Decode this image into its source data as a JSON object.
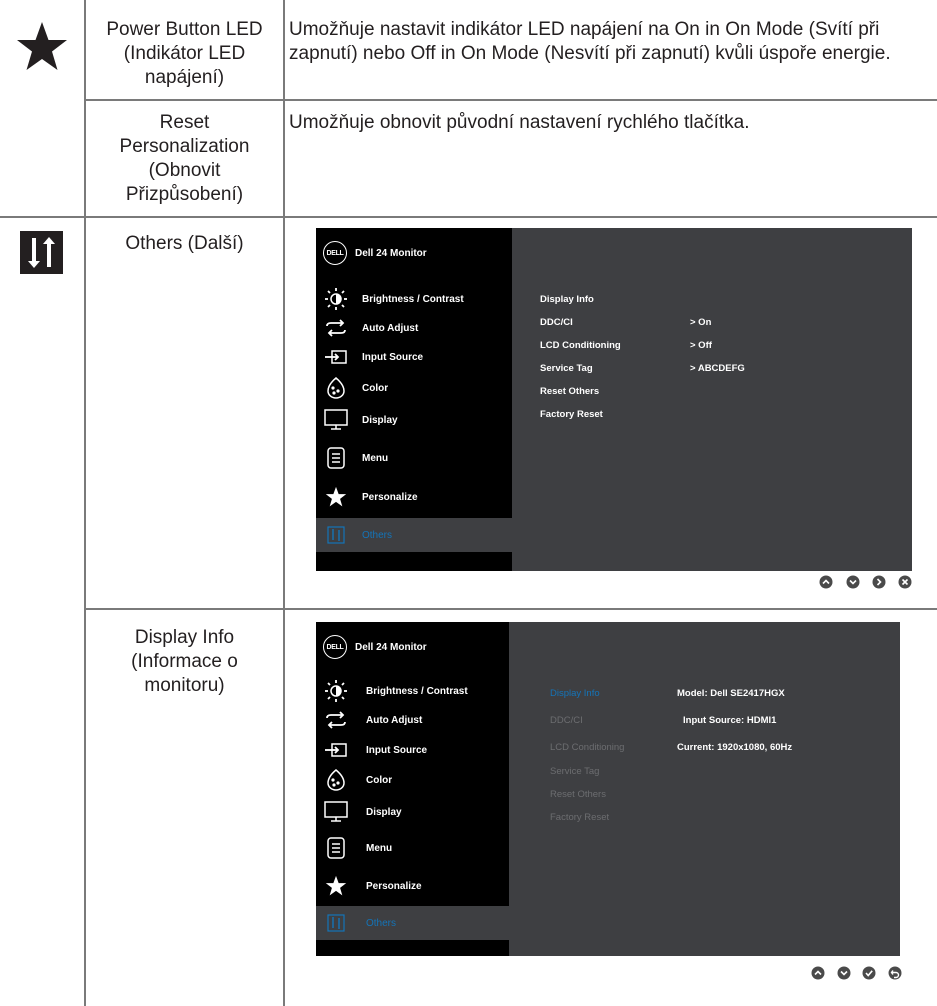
{
  "rows": [
    {
      "label": "Power Button LED\n(Indikátor LED\nnapájení)",
      "description": "Umožňuje nastavit indikátor LED napájení na On in On Mode (Svítí při zapnutí) nebo Off in On Mode (Nesvítí při zapnutí) kvůli úspoře energie.",
      "icon": "star-icon"
    },
    {
      "label": "Reset\nPersonalization\n(Obnovit\nPřizpůsobení)",
      "description": "Umožňuje obnovit původní nastavení rychlého tlačítka."
    },
    {
      "label": "Others (Další)",
      "icon": "others-sliders-icon"
    },
    {
      "label": "Display Info\n(Informace o\nmonitoru)"
    }
  ],
  "osd": {
    "brand": "DELL",
    "title": "Dell 24 Monitor",
    "menu": [
      {
        "label": "Brightness / Contrast",
        "icon": "brightness-icon"
      },
      {
        "label": "Auto Adjust",
        "icon": "auto-adjust-icon"
      },
      {
        "label": "Input Source",
        "icon": "input-source-icon"
      },
      {
        "label": "Color",
        "icon": "color-icon"
      },
      {
        "label": "Display",
        "icon": "display-icon"
      },
      {
        "label": "Menu",
        "icon": "menu-icon"
      },
      {
        "label": "Personalize",
        "icon": "star-icon"
      },
      {
        "label": "Others",
        "icon": "others-icon"
      }
    ],
    "others_items": [
      {
        "label": "Display Info",
        "value": ""
      },
      {
        "label": "DDC/CI",
        "value": ">  On"
      },
      {
        "label": "LCD Conditioning",
        "value": ">  Off"
      },
      {
        "label": "Service Tag",
        "value": ">  ABCDEFG"
      },
      {
        "label": "Reset Others",
        "value": ""
      },
      {
        "label": "Factory Reset",
        "value": ""
      }
    ],
    "info_values": [
      "Model:  Dell SE2417HGX",
      "Input Source: HDMI1",
      "Current: 1920x1080, 60Hz"
    ],
    "nav_buttons_1": [
      "up-icon",
      "down-icon",
      "right-icon",
      "close-icon"
    ],
    "nav_buttons_2": [
      "up-icon",
      "down-icon",
      "check-icon",
      "back-icon"
    ]
  },
  "colors": {
    "osd_left": "#000000",
    "osd_right": "#3e3f42",
    "active_text": "#1474b8",
    "rule": "#7a7a7a"
  }
}
